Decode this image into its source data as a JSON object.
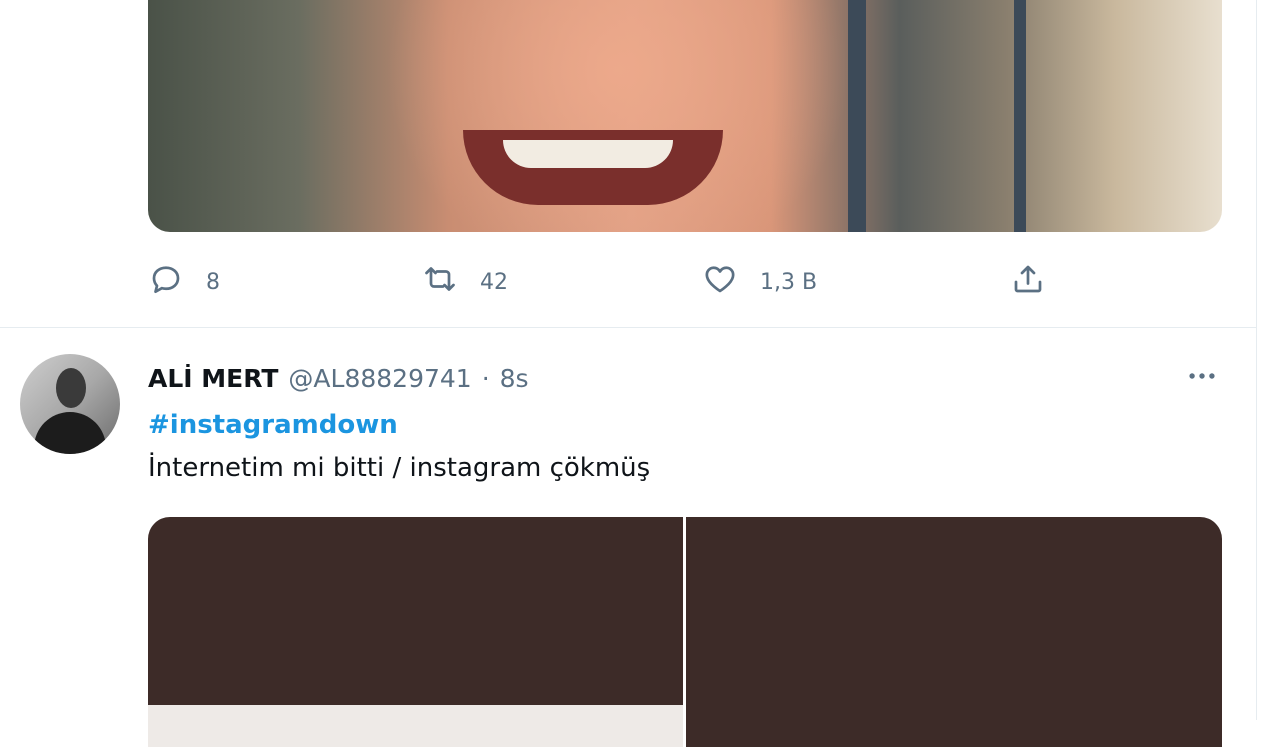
{
  "previous_tweet": {
    "actions": {
      "reply_count": "8",
      "retweet_count": "42",
      "like_count": "1,3 B"
    }
  },
  "tweet": {
    "display_name": "ALİ MERT",
    "handle": "@AL88829741",
    "separator": "·",
    "time": "8s",
    "hashtag": "#instagramdown",
    "text": "İnternetim mi bitti / instagram çökmüş"
  },
  "icons": [
    "reply-icon",
    "retweet-icon",
    "like-icon",
    "share-icon",
    "more-icon"
  ],
  "colors": {
    "text_primary": "#0f1419",
    "text_secondary": "#5b7083",
    "link": "#1b95e0",
    "divider": "#e6ecf0"
  }
}
